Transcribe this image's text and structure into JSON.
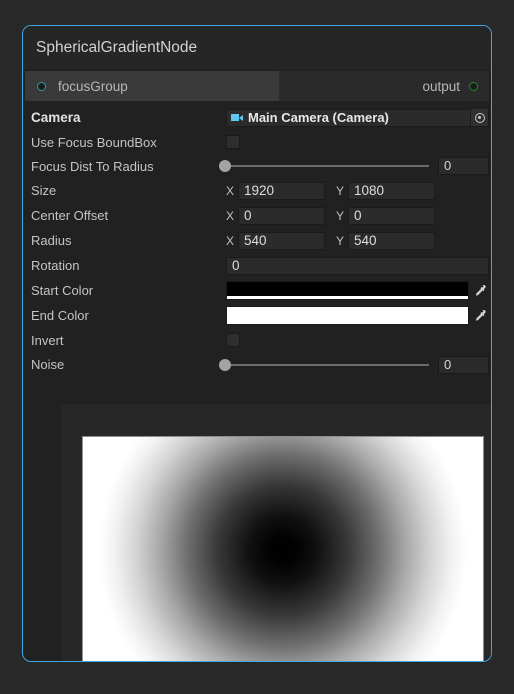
{
  "node": {
    "title": "SphericalGradientNode",
    "border_color": "#3fa9e0",
    "ports": {
      "input": {
        "label": "focusGroup",
        "dot_color": "#2f9aa8",
        "icon": "port-circle-icon"
      },
      "output": {
        "label": "output",
        "dot_color": "#1f8a2a",
        "icon": "port-circle-icon"
      }
    }
  },
  "properties": {
    "camera": {
      "label": "Camera",
      "value": "Main Camera (Camera)",
      "icon": "camera-icon",
      "picker_icon": "object-picker-icon"
    },
    "use_focus_boundbox": {
      "label": "Use Focus BoundBox",
      "checked": false
    },
    "focus_dist_to_radius": {
      "label": "Focus Dist To Radius",
      "value": "0",
      "slider_percent": 0
    },
    "size": {
      "label": "Size",
      "x_axis": "X",
      "y_axis": "Y",
      "x": "1920",
      "y": "1080"
    },
    "center_offset": {
      "label": "Center Offset",
      "x_axis": "X",
      "y_axis": "Y",
      "x": "0",
      "y": "0"
    },
    "radius": {
      "label": "Radius",
      "x_axis": "X",
      "y_axis": "Y",
      "x": "540",
      "y": "540"
    },
    "rotation": {
      "label": "Rotation",
      "value": "0"
    },
    "start_color": {
      "label": "Start Color",
      "color": "#000000",
      "alpha_color": "#ffffff",
      "eyedropper_icon": "eyedropper-icon"
    },
    "end_color": {
      "label": "End Color",
      "color": "#ffffff",
      "alpha_color": "#ffffff",
      "eyedropper_icon": "eyedropper-icon"
    },
    "invert": {
      "label": "Invert",
      "checked": false
    },
    "noise": {
      "label": "Noise",
      "value": "0",
      "slider_percent": 0
    }
  },
  "preview": {
    "name": "spherical-gradient-preview"
  }
}
